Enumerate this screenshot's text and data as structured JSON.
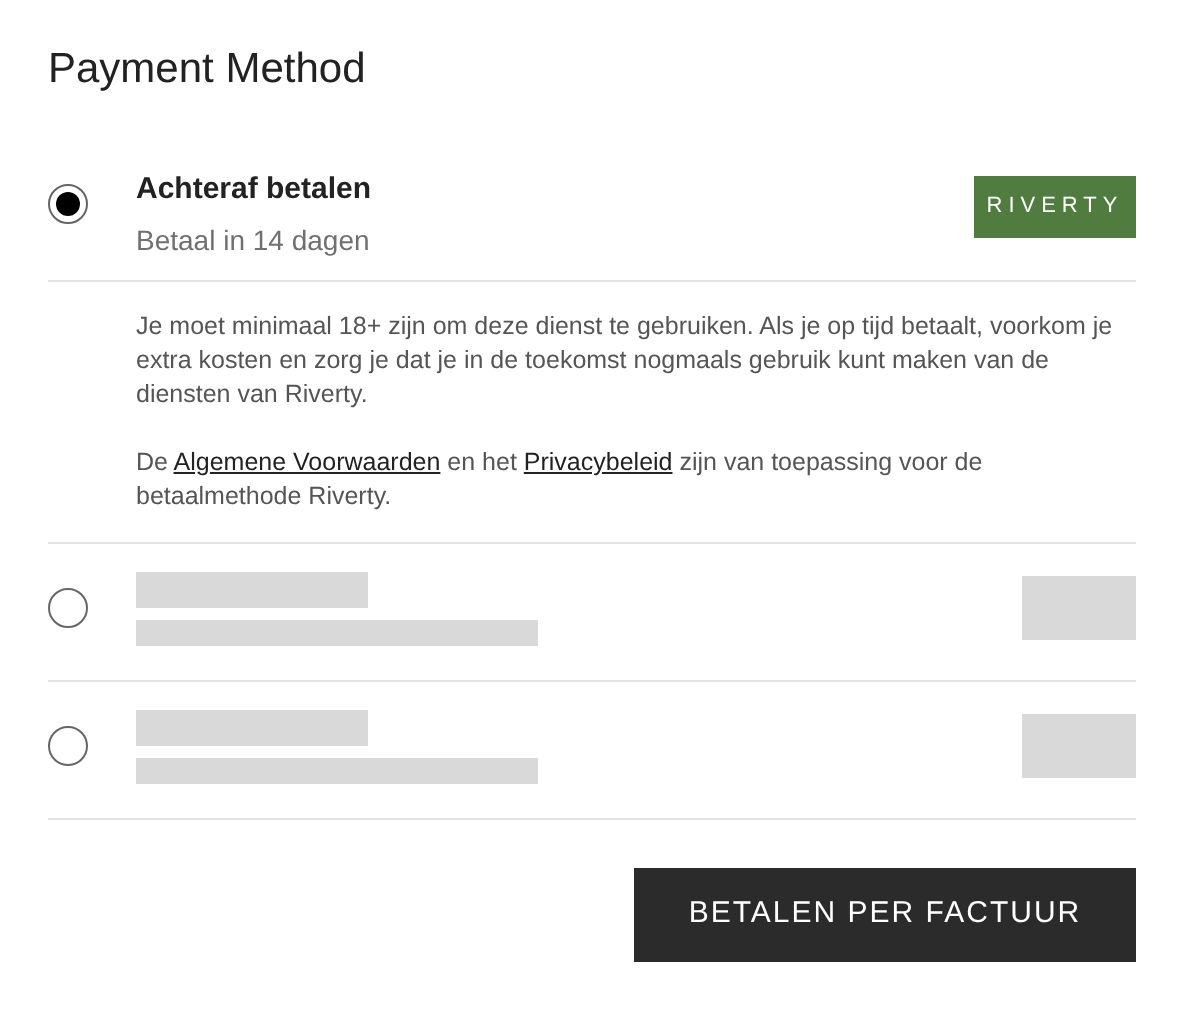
{
  "title": "Payment Method",
  "methods": [
    {
      "kind": "full",
      "selected": true,
      "name": "Achteraf betalen",
      "subtitle": "Betaal in 14 dagen",
      "logo": "RIVERTY",
      "description": "Je moet minimaal 18+ zijn om deze dienst te gebruiken. Als je op tijd betaalt, voorkom je extra kosten en zorg je dat je in de toekomst nogmaals gebruik kunt maken van de diensten van Riverty.",
      "terms": [
        {
          "kind": "text",
          "text": "De "
        },
        {
          "kind": "link",
          "text": "Algemene Voorwaarden"
        },
        {
          "kind": "text",
          "text": " en het "
        },
        {
          "kind": "link",
          "text": "Privacybeleid"
        },
        {
          "kind": "text",
          "text": " zijn van toepassing voor de betaalmethode Riverty."
        }
      ]
    },
    {
      "kind": "skeleton",
      "selected": false
    },
    {
      "kind": "skeleton",
      "selected": false
    }
  ],
  "submit": "BETALEN PER FACTUUR"
}
